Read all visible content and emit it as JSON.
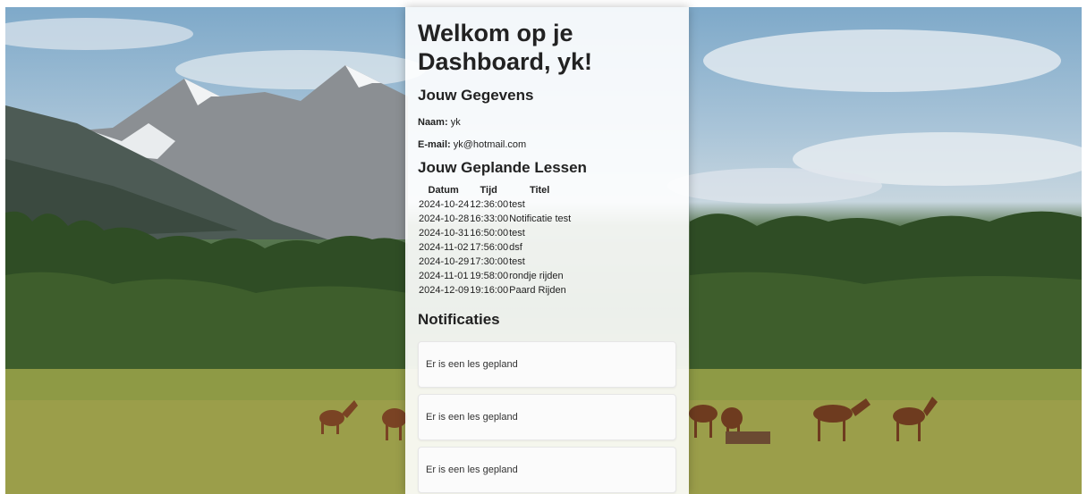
{
  "dashboard": {
    "title": "Welkom op je Dashboard, yk!"
  },
  "gegevens": {
    "heading": "Jouw Gegevens",
    "naam_label": "Naam:",
    "naam_value": "yk",
    "email_label": "E-mail:",
    "email_value": "yk@hotmail.com"
  },
  "lessen": {
    "heading": "Jouw Geplande Lessen",
    "columns": [
      "Datum",
      "Tijd",
      "Titel"
    ],
    "rows": [
      [
        "2024-10-24",
        "12:36:00",
        "test"
      ],
      [
        "2024-10-28",
        "16:33:00",
        "Notificatie test"
      ],
      [
        "2024-10-31",
        "16:50:00",
        "test"
      ],
      [
        "2024-11-02",
        "17:56:00",
        "dsf"
      ],
      [
        "2024-10-29",
        "17:30:00",
        "test"
      ],
      [
        "2024-11-01",
        "19:58:00",
        "rondje rijden"
      ],
      [
        "2024-12-09",
        "19:16:00",
        "Paard Rijden"
      ]
    ]
  },
  "notificaties": {
    "heading": "Notificaties",
    "items": [
      "Er is een les gepland",
      "Er is een les gepland",
      "Er is een les gepland"
    ]
  }
}
